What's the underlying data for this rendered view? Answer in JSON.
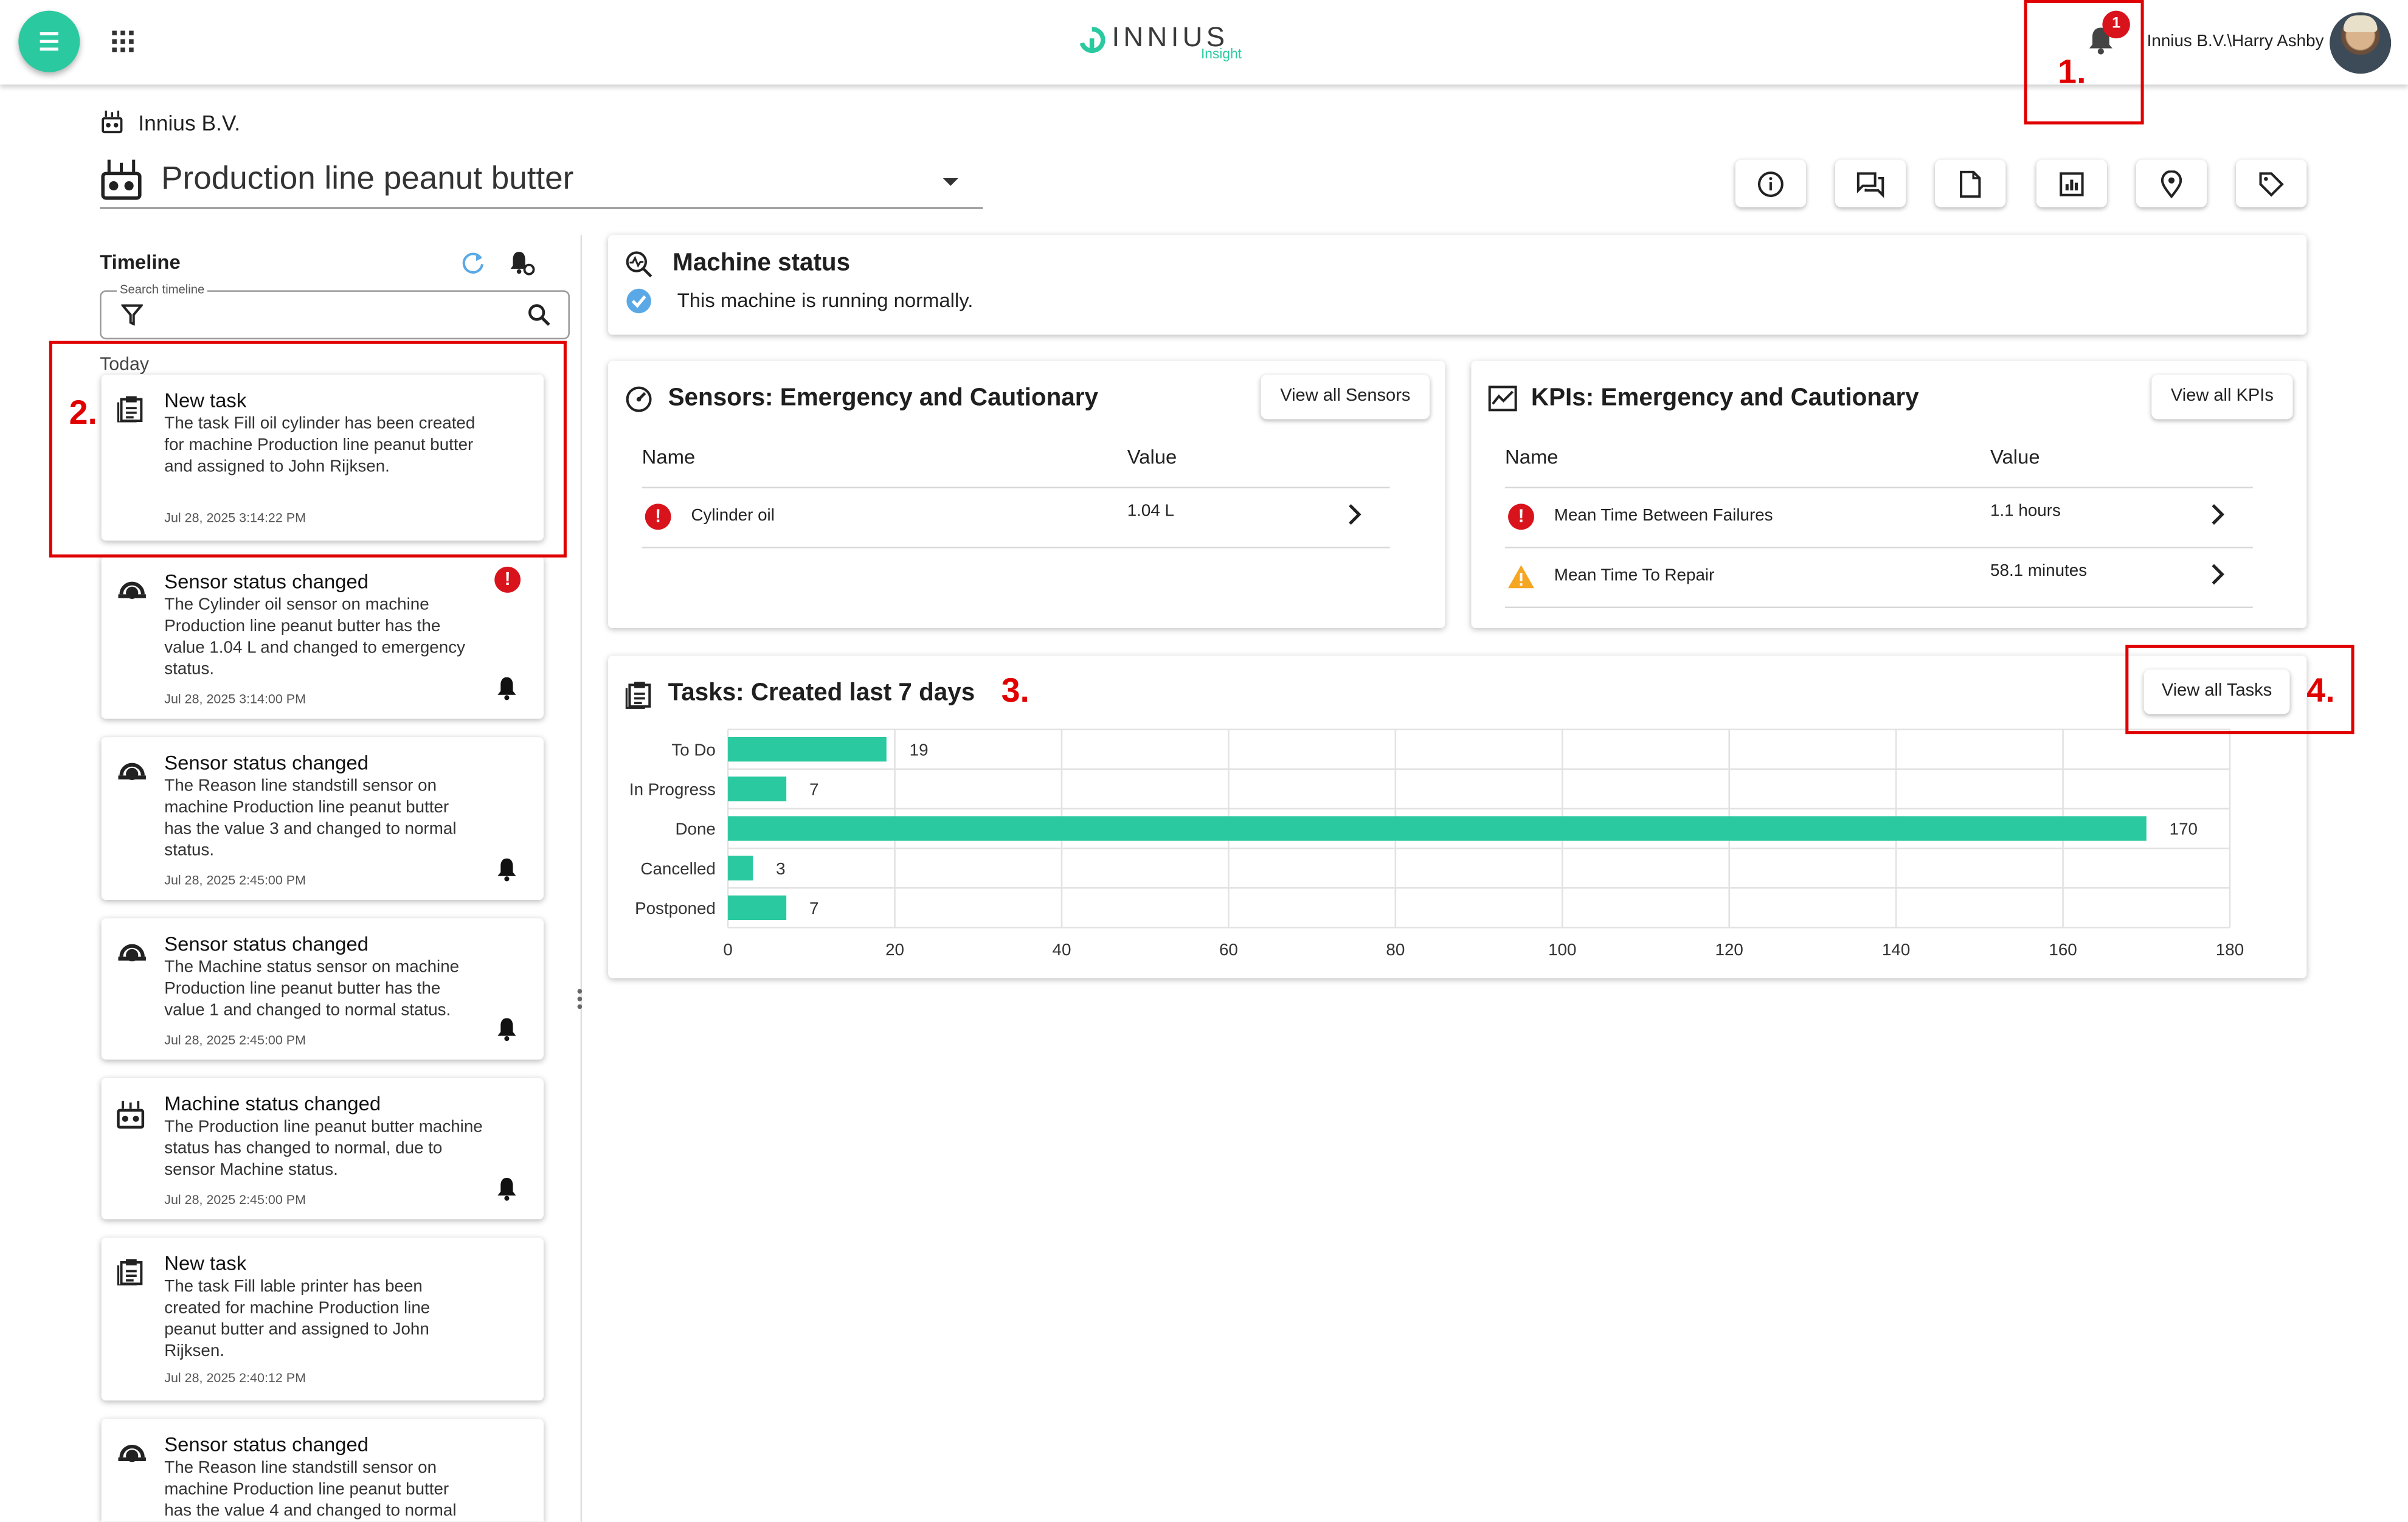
{
  "header": {
    "brand": "INNIUS",
    "brand_sub": "Insight",
    "notification_count": "1",
    "user": "Innius B.V.\\Harry Ashby"
  },
  "annotations": [
    "1.",
    "2.",
    "3.",
    "4."
  ],
  "company": "Innius B.V.",
  "machine": {
    "name": "Production line peanut butter"
  },
  "toolbar": {
    "icons": [
      "info-icon",
      "chat-icon",
      "document-icon",
      "report-icon",
      "location-icon",
      "tag-icon"
    ]
  },
  "timeline": {
    "title": "Timeline",
    "search_label": "Search timeline",
    "group": "Today",
    "items": [
      {
        "title": "New task",
        "icon": "task-icon",
        "body": "The task Fill oil cylinder has been created for machine Production line peanut butter and assigned to John Rijksen.",
        "date": "Jul 28, 2025 3:14:22 PM"
      },
      {
        "title": "Sensor status changed",
        "icon": "sensor-icon",
        "alert": "!",
        "body": "The Cylinder oil sensor on machine Production line peanut butter has the value 1.04 L and changed to emergency status.",
        "date": "Jul 28, 2025 3:14:00 PM"
      },
      {
        "title": "Sensor status changed",
        "icon": "sensor-icon",
        "body": "The Reason line standstill sensor on machine Production line peanut butter has the value 3 and changed to normal status.",
        "date": "Jul 28, 2025 2:45:00 PM"
      },
      {
        "title": "Sensor status changed",
        "icon": "sensor-icon",
        "body": "The Machine status sensor on machine Production line peanut butter has the value 1 and changed to normal status.",
        "date": "Jul 28, 2025 2:45:00 PM"
      },
      {
        "title": "Machine status changed",
        "icon": "machine-icon",
        "body": "The Production line peanut butter machine status has changed to normal, due to sensor Machine status.",
        "date": "Jul 28, 2025 2:45:00 PM"
      },
      {
        "title": "New task",
        "icon": "task-icon",
        "body": "The task Fill lable printer has been created for machine Production line peanut butter and assigned to John Rijksen.",
        "date": "Jul 28, 2025 2:40:12 PM"
      },
      {
        "title": "Sensor status changed",
        "icon": "sensor-icon",
        "body": "The Reason line standstill sensor on machine Production line peanut butter has the value 4 and changed to normal",
        "date": ""
      }
    ]
  },
  "machine_status": {
    "title": "Machine status",
    "message": "This machine is running normally."
  },
  "sensors": {
    "title": "Sensors: Emergency and Cautionary",
    "button": "View all Sensors",
    "col_name": "Name",
    "col_value": "Value",
    "rows": [
      {
        "status": "emergency",
        "name": "Cylinder oil",
        "value": "1.04 L"
      }
    ]
  },
  "kpis": {
    "title": "KPIs: Emergency and Cautionary",
    "button": "View all KPIs",
    "col_name": "Name",
    "col_value": "Value",
    "rows": [
      {
        "status": "emergency",
        "name": "Mean Time Between Failures",
        "value": "1.1 hours"
      },
      {
        "status": "warning",
        "name": "Mean Time To Repair",
        "value": "58.1 minutes"
      }
    ]
  },
  "tasks": {
    "title": "Tasks: Created last 7 days",
    "button": "View all Tasks"
  },
  "chart_data": {
    "type": "bar",
    "orientation": "horizontal",
    "categories": [
      "To Do",
      "In Progress",
      "Done",
      "Cancelled",
      "Postponed"
    ],
    "values": [
      19,
      7,
      170,
      3,
      7
    ],
    "xlim": [
      0,
      180
    ],
    "xticks": [
      0,
      20,
      40,
      60,
      80,
      100,
      120,
      140,
      160,
      180
    ],
    "grid": true,
    "color": "#2bc9a0"
  },
  "colors": {
    "accent": "#2bc9a0",
    "emergency": "#d9131c",
    "warning": "#f5a623",
    "ok": "#5aa9e6"
  }
}
